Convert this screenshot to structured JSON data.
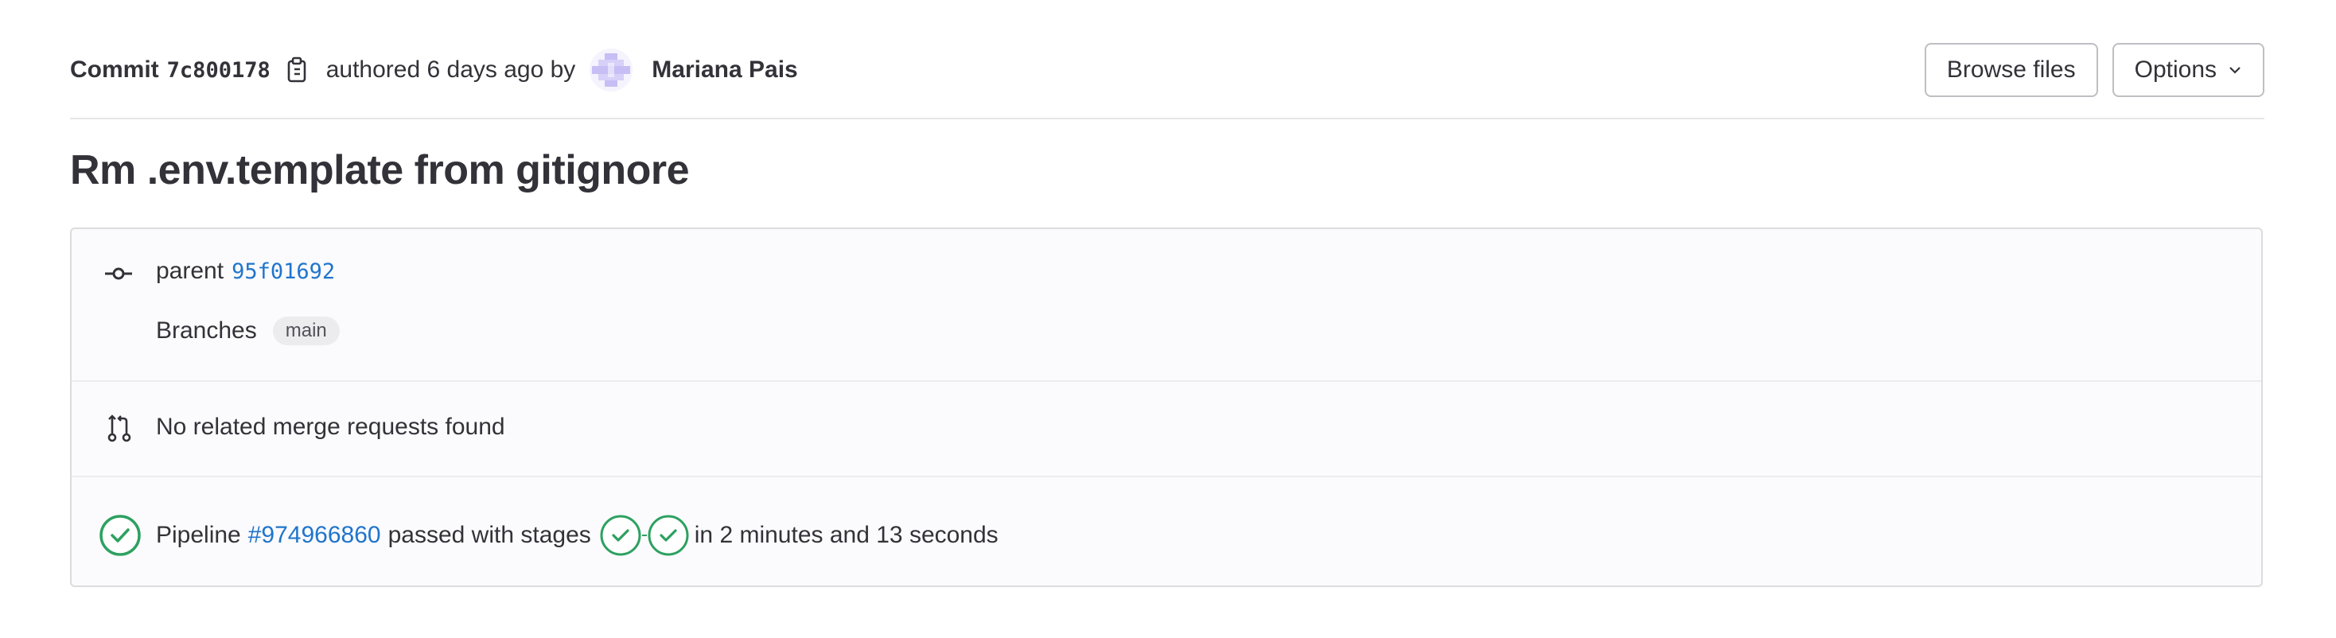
{
  "header": {
    "commit_label": "Commit",
    "commit_sha": "7c800178",
    "authored_text": "authored 6 days ago by",
    "author_name": "Mariana Pais",
    "copy_icon": "clipboard-icon",
    "buttons": {
      "browse_files": "Browse files",
      "options": "Options"
    }
  },
  "title": "Rm .env.template from gitignore",
  "info": {
    "parent_label": "parent",
    "parent_sha": "95f01692",
    "branches_label": "Branches",
    "branch_name": "main",
    "merge_requests_text": "No related merge requests found",
    "pipeline_label": "Pipeline",
    "pipeline_id": "#974966860",
    "pipeline_status_text": "passed with stages",
    "pipeline_duration": "in 2 minutes and 13 seconds"
  },
  "colors": {
    "link": "#1f75cb",
    "success": "#2da160",
    "text": "#333238",
    "panel_bg": "#fbfafd",
    "avatar": "#c7bef5"
  }
}
